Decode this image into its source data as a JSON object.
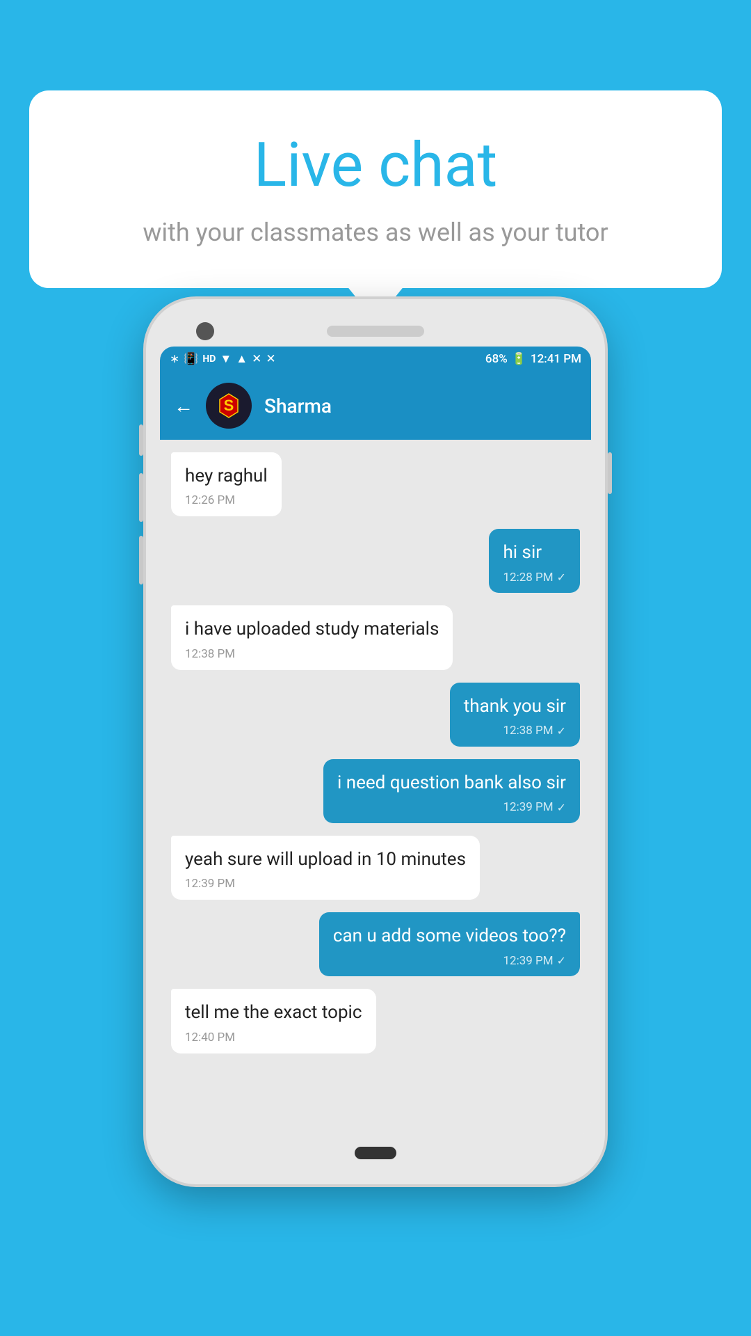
{
  "callout": {
    "title": "Live chat",
    "subtitle": "with your classmates as well as your tutor"
  },
  "status_bar": {
    "time": "12:41 PM",
    "battery": "68%",
    "icons": "bluetooth, signal, hd, wifi, x-network"
  },
  "chat_header": {
    "contact_name": "Sharma",
    "back_label": "←"
  },
  "messages": [
    {
      "id": "msg1",
      "direction": "incoming",
      "text": "hey raghul",
      "time": "12:26 PM",
      "show_check": false
    },
    {
      "id": "msg2",
      "direction": "outgoing",
      "text": "hi sir",
      "time": "12:28 PM",
      "show_check": true
    },
    {
      "id": "msg3",
      "direction": "incoming",
      "text": "i have uploaded study materials",
      "time": "12:38 PM",
      "show_check": false
    },
    {
      "id": "msg4",
      "direction": "outgoing",
      "text": "thank you sir",
      "time": "12:38 PM",
      "show_check": true
    },
    {
      "id": "msg5",
      "direction": "outgoing",
      "text": "i need question bank also sir",
      "time": "12:39 PM",
      "show_check": true
    },
    {
      "id": "msg6",
      "direction": "incoming",
      "text": "yeah sure will upload in 10 minutes",
      "time": "12:39 PM",
      "show_check": false
    },
    {
      "id": "msg7",
      "direction": "outgoing",
      "text": "can u add some videos too??",
      "time": "12:39 PM",
      "show_check": true
    },
    {
      "id": "msg8",
      "direction": "incoming",
      "text": "tell me the exact topic",
      "time": "12:40 PM",
      "show_check": false
    }
  ]
}
